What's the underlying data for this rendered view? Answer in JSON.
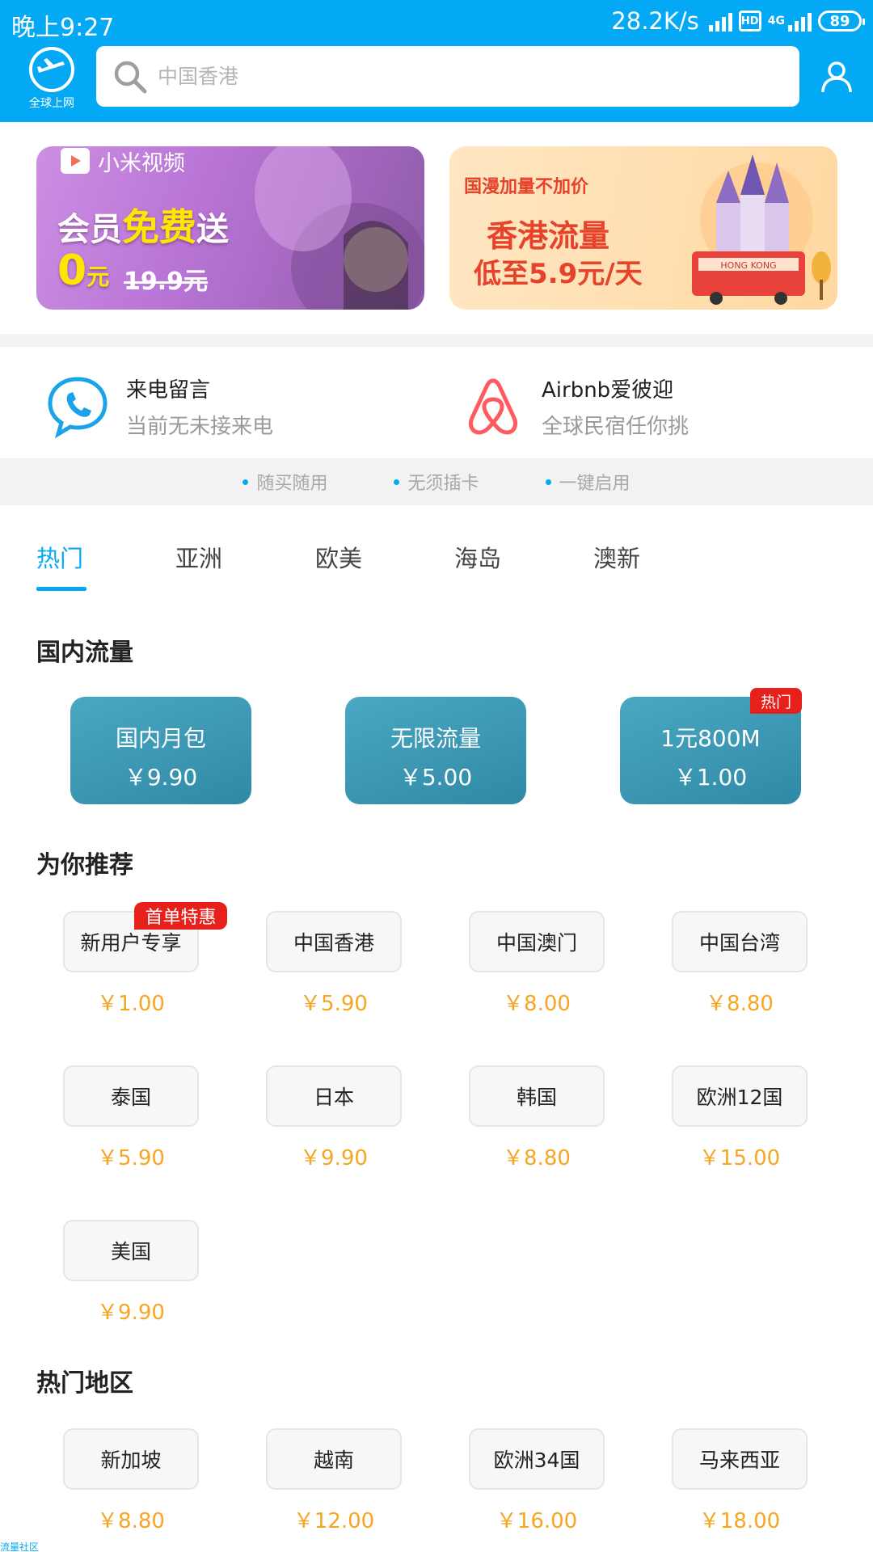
{
  "status_bar": {
    "time": "晚上9:27",
    "net_speed": "28.2K/s",
    "hd": "HD",
    "network": "4G",
    "battery": "89"
  },
  "header": {
    "logo_label": "全球上网",
    "search_placeholder": "中国香港"
  },
  "banners": {
    "left": {
      "brand": "小米视频",
      "title_prefix": "会员",
      "title_highlight": "免费",
      "title_suffix": "送",
      "price": "0",
      "price_unit": "元",
      "old_price": "19.9元"
    },
    "right": {
      "tagline": "国漫加量不加价",
      "line1": "香港流量",
      "line2": "低至5.9元/天",
      "sign": "HONG KONG"
    }
  },
  "services": [
    {
      "title": "来电留言",
      "subtitle": "当前无未接来电",
      "icon": "phone-chat-icon"
    },
    {
      "title": "Airbnb爱彼迎",
      "subtitle": "全球民宿任你挑",
      "icon": "airbnb-icon"
    }
  ],
  "features": [
    "随买随用",
    "无须插卡",
    "一键启用"
  ],
  "tabs": [
    "热门",
    "亚洲",
    "欧美",
    "海岛",
    "澳新"
  ],
  "domestic": {
    "title": "国内流量",
    "hot_label": "热门",
    "items": [
      {
        "name": "国内月包",
        "price": "￥9.90"
      },
      {
        "name": "无限流量",
        "price": "￥5.00"
      },
      {
        "name": "1元800M",
        "price": "￥1.00"
      }
    ]
  },
  "recommend": {
    "title": "为你推荐",
    "first_order_label": "首单特惠",
    "items": [
      {
        "name": "新用户专享",
        "price": "￥1.00"
      },
      {
        "name": "中国香港",
        "price": "￥5.90"
      },
      {
        "name": "中国澳门",
        "price": "￥8.00"
      },
      {
        "name": "中国台湾",
        "price": "￥8.80"
      },
      {
        "name": "泰国",
        "price": "￥5.90"
      },
      {
        "name": "日本",
        "price": "￥9.90"
      },
      {
        "name": "韩国",
        "price": "￥8.80"
      },
      {
        "name": "欧洲12国",
        "price": "￥15.00"
      },
      {
        "name": "美国",
        "price": "￥9.90"
      }
    ]
  },
  "hot_regions": {
    "title": "热门地区",
    "items": [
      {
        "name": "新加坡",
        "price": "￥8.80"
      },
      {
        "name": "越南",
        "price": "￥12.00"
      },
      {
        "name": "欧洲34国",
        "price": "￥16.00"
      },
      {
        "name": "马来西亚",
        "price": "￥18.00"
      }
    ]
  },
  "watermark": "流量社区",
  "colors": {
    "accent": "#03A9F4",
    "price": "#F5A623",
    "hot_tag": "#E8201B",
    "card": "#3A98B4"
  }
}
